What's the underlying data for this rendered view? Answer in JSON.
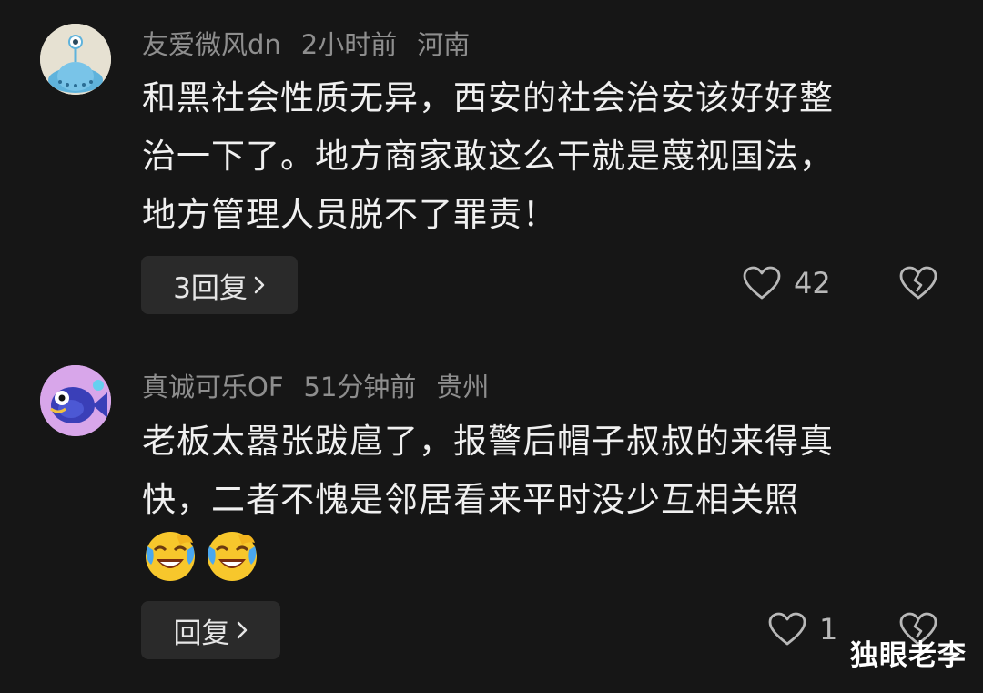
{
  "comments": [
    {
      "username": "友爱微风dn",
      "time": "2小时前",
      "location": "河南",
      "lines": [
        "和黑社会性质无异，西安的社会治安该好好整",
        "治一下了。地方商家敢这么干就是蔑视国法，",
        "地方管理人员脱不了罪责！"
      ],
      "reply_label": "3回复",
      "like_count": "42",
      "avatar_icon": "alien-avatar-icon"
    },
    {
      "username": "真诚可乐OF",
      "time": "51分钟前",
      "location": "贵州",
      "lines": [
        "老板太嚣张跋扈了，报警后帽子叔叔的来得真",
        "快，二者不愧是邻居看来平时没少互相关照"
      ],
      "emojis": [
        "laughing-crying-emoji",
        "laughing-crying-emoji"
      ],
      "reply_label": "回复",
      "like_count": "1",
      "avatar_icon": "fish-avatar-icon"
    }
  ],
  "watermark": "独眼老李",
  "colors": {
    "background": "#161616",
    "meta_text": "#8e8e8e",
    "body_text": "#f0f0f0",
    "reply_bg": "#2a2a2a"
  }
}
